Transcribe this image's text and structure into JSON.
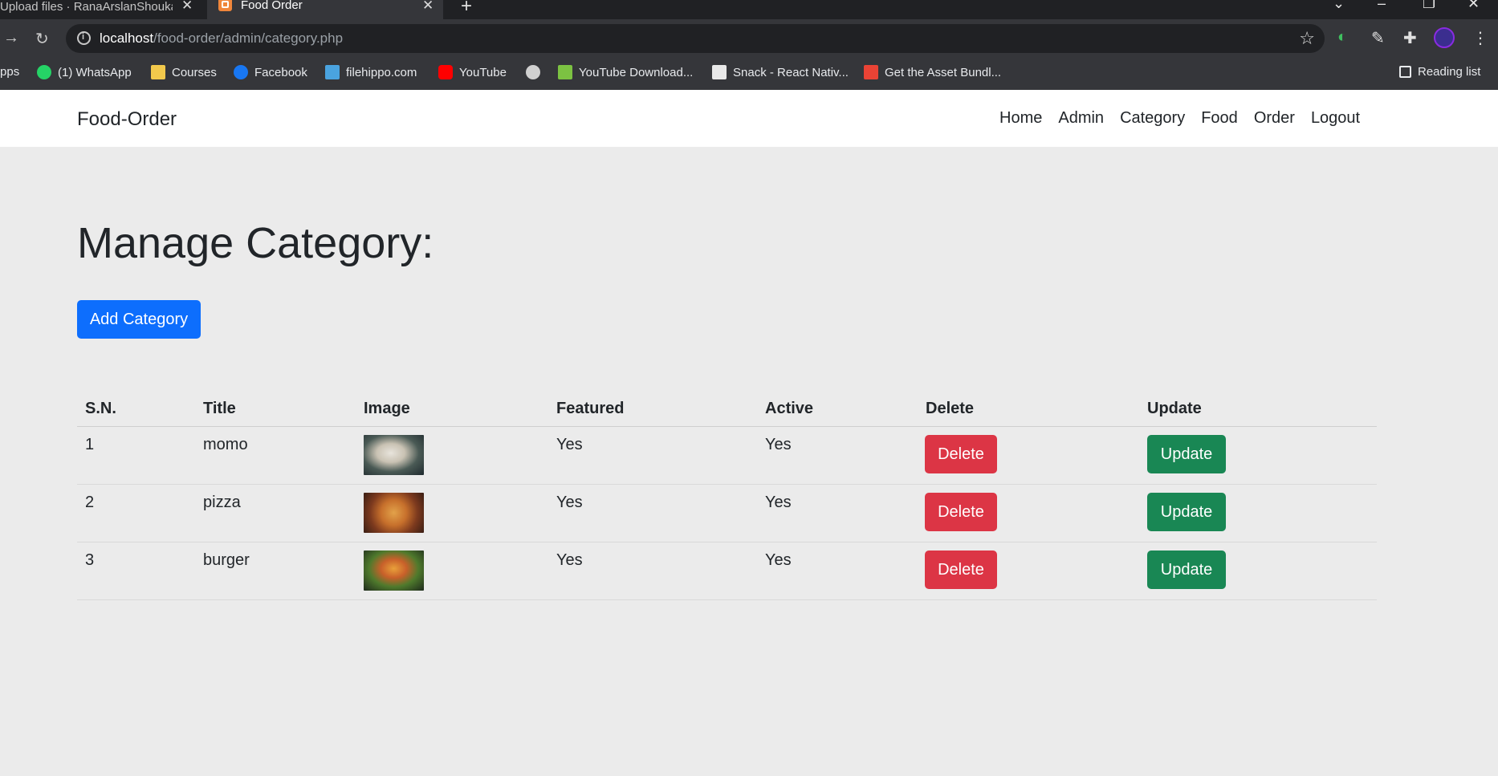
{
  "browser": {
    "tabs": [
      {
        "title": "Upload files · RanaArslanShoukat",
        "active": false
      },
      {
        "title": "Food Order",
        "active": true
      }
    ],
    "address": {
      "host": "localhost",
      "path": "/food-order/admin/category.php"
    },
    "bookmarks": [
      {
        "label": "Apps",
        "icon": "apps-icon"
      },
      {
        "label": "(1) WhatsApp",
        "icon": "whatsapp-icon"
      },
      {
        "label": "Courses",
        "icon": "courses-icon"
      },
      {
        "label": "Facebook",
        "icon": "facebook-icon"
      },
      {
        "label": "filehippo.com",
        "icon": "filehippo-icon"
      },
      {
        "label": "YouTube",
        "icon": "youtube-icon"
      },
      {
        "label": "",
        "icon": "globe-icon"
      },
      {
        "label": "YouTube Download...",
        "icon": "download-icon"
      },
      {
        "label": "Snack - React Nativ...",
        "icon": "snack-icon"
      },
      {
        "label": "Get the Asset Bundl...",
        "icon": "gmail-icon"
      }
    ],
    "reading_list": "Reading list"
  },
  "navbar": {
    "brand": "Food-Order",
    "links": [
      "Home",
      "Admin",
      "Category",
      "Food",
      "Order",
      "Logout"
    ]
  },
  "main": {
    "title": "Manage Category:",
    "add_button": "Add Category",
    "table": {
      "headers": [
        "S.N.",
        "Title",
        "Image",
        "Featured",
        "Active",
        "Delete",
        "Update"
      ],
      "rows": [
        {
          "sn": "1",
          "title": "momo",
          "image": "momo-thumbnail",
          "featured": "Yes",
          "active": "Yes",
          "delete": "Delete",
          "update": "Update"
        },
        {
          "sn": "2",
          "title": "pizza",
          "image": "pizza-thumbnail",
          "featured": "Yes",
          "active": "Yes",
          "delete": "Delete",
          "update": "Update"
        },
        {
          "sn": "3",
          "title": "burger",
          "image": "burger-thumbnail",
          "featured": "Yes",
          "active": "Yes",
          "delete": "Delete",
          "update": "Update"
        }
      ]
    }
  },
  "colors": {
    "primary": "#0d6efd",
    "danger": "#dc3545",
    "success": "#198754",
    "page_bg": "#ebebeb"
  }
}
